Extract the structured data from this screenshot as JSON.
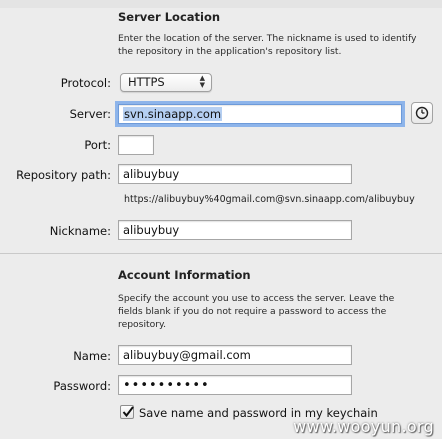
{
  "server_section": {
    "title": "Server Location",
    "help": "Enter the location of the server. The nickname is used to identify the repository in the application's repository list."
  },
  "fields": {
    "protocol_label": "Protocol:",
    "protocol_value": "HTTPS",
    "server_label": "Server:",
    "server_value": "svn.sinaapp.com",
    "port_label": "Port:",
    "port_value": "",
    "repo_path_label": "Repository path:",
    "repo_path_value": "alibuybuy",
    "repo_url": "https://alibuybuy%40gmail.com@svn.sinaapp.com/alibuybuy",
    "nickname_label": "Nickname:",
    "nickname_value": "alibuybuy"
  },
  "account_section": {
    "title": "Account Information",
    "help": "Specify the account you use to access the server. Leave the fields blank if you do not require a password to access the repository.",
    "name_label": "Name:",
    "name_value": "alibuybuy@gmail.com",
    "password_label": "Password:",
    "password_value": "••••••••••",
    "save_checkbox_label": "Save name and password in my keychain",
    "save_checked": true
  },
  "icons": {
    "server_browse_button": "clock-icon",
    "protocol_arrows": "up-down-arrows-icon",
    "checkbox_mark": "checkmark-icon"
  },
  "watermark": "www.wooyun.org",
  "colors": {
    "background": "#ececec",
    "focus_ring": "#8db4ea",
    "selection": "#b5cff2"
  }
}
